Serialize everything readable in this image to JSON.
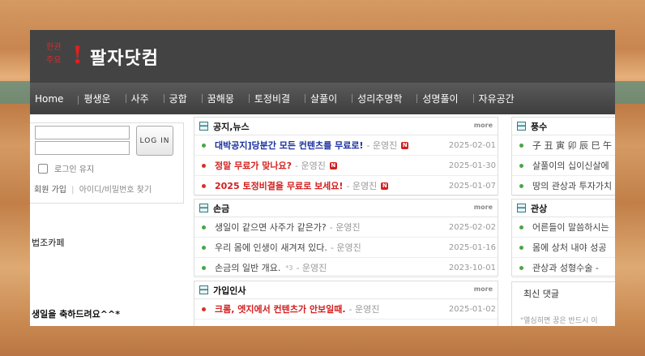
{
  "logo": {
    "small1": "한권",
    "small2": "주요",
    "bang": "!",
    "name": "팔자닷컴"
  },
  "nav": [
    "Home",
    "평생운",
    "사주",
    "궁합",
    "꿈해몽",
    "토정비결",
    "살풀이",
    "성리추명학",
    "성명풀이",
    "자유공간"
  ],
  "login": {
    "button": "LOG IN",
    "keep_label": "로그인 유지",
    "join": "회원 가입",
    "sep": "|",
    "find": "아이디/비밀번호 찾기"
  },
  "left": {
    "text1": "법조카페",
    "text2": "생일을 축하드려요^^*"
  },
  "more_label": "more",
  "panels": {
    "notice": {
      "title": "공지,뉴스",
      "rows": [
        {
          "title": "대박공지]당분간 모든 컨텐츠를 무료로!",
          "author": "- 운영진",
          "badge": "N",
          "date": "2025-02-01"
        },
        {
          "title": "정말 무료가 맞나요?",
          "author": "- 운영진",
          "badge": "N",
          "date": "2025-01-30"
        },
        {
          "title": "2025 토정비결을 무료로 보세요!",
          "author": "- 운영진",
          "badge": "N",
          "date": "2025-01-07"
        }
      ]
    },
    "songeum": {
      "title": "손금",
      "rows": [
        {
          "title": "생일이 같으면 사주가 같은가?",
          "author": "- 운영진",
          "date": "2025-02-02"
        },
        {
          "title": "우리 몸에 인생이 새겨져 있다.",
          "author": "- 운영진",
          "date": "2025-01-16"
        },
        {
          "title": "손금의 일반 개요.",
          "comments": "*3",
          "author": "- 운영진",
          "date": "2023-10-01"
        }
      ]
    },
    "greet": {
      "title": "가입인사",
      "rows": [
        {
          "title": "크롬, 엣지에서 컨텐츠가 안보일때.",
          "author": "- 운영진",
          "date": "2025-01-02"
        }
      ]
    },
    "fengshui": {
      "title": "풍수",
      "rows": [
        {
          "title": "子 丑 寅 卯 辰 巳 午"
        },
        {
          "title": "살풀이의 십이신살에"
        },
        {
          "title": "땅의 관상과 투자가치"
        }
      ]
    },
    "gwansang": {
      "title": "관상",
      "rows": [
        {
          "title": "어른들이 말씀하시는"
        },
        {
          "title": "몸에 상처 내야 성공"
        },
        {
          "title": "관상과 성형수술 -"
        }
      ]
    },
    "comments": {
      "title": "최신 댓글",
      "sub": "\"열심히면 꿈은 반드시 이"
    }
  }
}
